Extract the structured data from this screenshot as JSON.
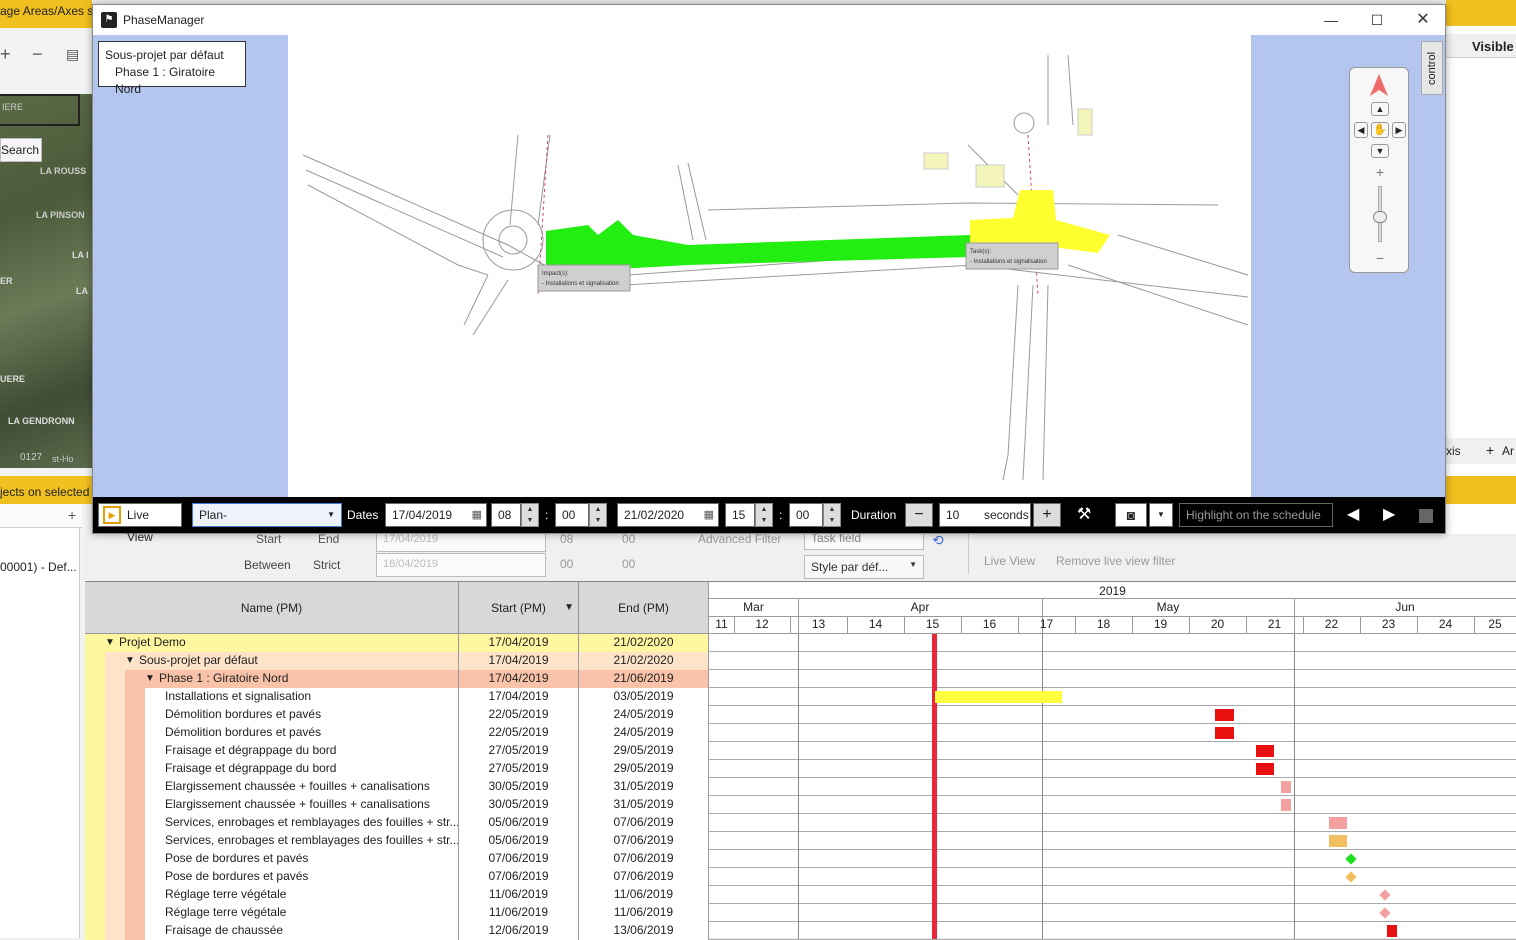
{
  "background": {
    "top_text": "age Areas/Axes s",
    "search_label": "Search",
    "map_labels": [
      "IERE",
      "LA ROUSS",
      "LA PINSON",
      "LA I",
      "ER",
      "LA",
      "UERE",
      "LA GENDRONN",
      "0127",
      "st-Ho"
    ],
    "status_text": "jects on selected",
    "tree_item": "00001) - Def...",
    "right_header": "Visible",
    "right_axis": "xis",
    "right_add": "Ar"
  },
  "window": {
    "title": "PhaseManager",
    "breadcrumb": {
      "line1": "Sous-projet par défaut",
      "line2": "Phase 1 : Giratoire Nord"
    },
    "control_tab": "control",
    "callouts": [
      {
        "title": "Impact(s):",
        "text": "- Installations et signalisation"
      },
      {
        "title": "Task(s):",
        "text": "- Installations et signalisation"
      }
    ]
  },
  "toolbar": {
    "live_view": "Live View",
    "plan_select": "Plan-",
    "dates_label": "Dates",
    "start_date": "17/04/2019",
    "start_hour": "08",
    "start_min": "00",
    "end_date": "21/02/2020",
    "end_hour": "15",
    "end_min": "00",
    "duration_label": "Duration",
    "duration_value": "10",
    "duration_unit": "seconds",
    "highlight_placeholder": "Highlight on the schedule"
  },
  "filters": {
    "start": "Start",
    "end": "End",
    "between": "Between",
    "strict": "Strict",
    "date1": "17/04/2019",
    "date2": "18/04/2019",
    "h1": "08",
    "m1": "00",
    "h2": "00",
    "m2": "00",
    "advanced": "Advanced Filter",
    "task_field": "Task field",
    "style": "Style par déf...",
    "live_view": "Live View",
    "remove_filter": "Remove live view filter"
  },
  "grid": {
    "headers": {
      "name": "Name (PM)",
      "start": "Start (PM)",
      "end": "End (PM)"
    },
    "rows": [
      {
        "name": "Projet Demo",
        "start": "17/04/2019",
        "end": "21/02/2020",
        "level": 0
      },
      {
        "name": "Sous-projet par défaut",
        "start": "17/04/2019",
        "end": "21/02/2020",
        "level": 1
      },
      {
        "name": "Phase 1 : Giratoire Nord",
        "start": "17/04/2019",
        "end": "21/06/2019",
        "level": 2
      },
      {
        "name": "Installations et signalisation",
        "start": "17/04/2019",
        "end": "03/05/2019",
        "level": 3
      },
      {
        "name": "Démolition bordures et pavés",
        "start": "22/05/2019",
        "end": "24/05/2019",
        "level": 3
      },
      {
        "name": "Démolition bordures et pavés",
        "start": "22/05/2019",
        "end": "24/05/2019",
        "level": 3
      },
      {
        "name": "Fraisage et dégrappage du bord",
        "start": "27/05/2019",
        "end": "29/05/2019",
        "level": 3
      },
      {
        "name": "Fraisage et dégrappage du bord",
        "start": "27/05/2019",
        "end": "29/05/2019",
        "level": 3
      },
      {
        "name": "Elargissement chaussée + fouilles + canalisations",
        "start": "30/05/2019",
        "end": "31/05/2019",
        "level": 3
      },
      {
        "name": "Elargissement chaussée + fouilles + canalisations",
        "start": "30/05/2019",
        "end": "31/05/2019",
        "level": 3
      },
      {
        "name": "Services, enrobages et remblayages des fouilles + str...",
        "start": "05/06/2019",
        "end": "07/06/2019",
        "level": 3
      },
      {
        "name": "Services, enrobages et remblayages des fouilles + str...",
        "start": "05/06/2019",
        "end": "07/06/2019",
        "level": 3
      },
      {
        "name": "Pose de bordures et pavés",
        "start": "07/06/2019",
        "end": "07/06/2019",
        "level": 3
      },
      {
        "name": "Pose de bordures et pavés",
        "start": "07/06/2019",
        "end": "07/06/2019",
        "level": 3
      },
      {
        "name": "Réglage terre végétale",
        "start": "11/06/2019",
        "end": "11/06/2019",
        "level": 3
      },
      {
        "name": "Réglage terre végétale",
        "start": "11/06/2019",
        "end": "11/06/2019",
        "level": 3
      },
      {
        "name": "Fraisage de chaussée",
        "start": "12/06/2019",
        "end": "13/06/2019",
        "level": 3
      }
    ]
  },
  "timeline": {
    "year": "2019",
    "months": [
      {
        "label": "Mar"
      },
      {
        "label": "Apr"
      },
      {
        "label": "May"
      },
      {
        "label": "Jun"
      }
    ],
    "weeks": [
      "11",
      "12",
      "13",
      "14",
      "15",
      "16",
      "17",
      "18",
      "19",
      "20",
      "21",
      "22",
      "23",
      "24",
      "25"
    ],
    "bars": [
      {
        "row": 3,
        "shape": "bar",
        "color": "#ffff40"
      },
      {
        "row": 4,
        "shape": "bar",
        "color": "#e81010"
      },
      {
        "row": 5,
        "shape": "bar",
        "color": "#e81010"
      },
      {
        "row": 6,
        "shape": "bar",
        "color": "#e81010"
      },
      {
        "row": 7,
        "shape": "bar",
        "color": "#e81010"
      },
      {
        "row": 8,
        "shape": "bar",
        "color": "#f4a0a0"
      },
      {
        "row": 9,
        "shape": "bar",
        "color": "#f4a0a0"
      },
      {
        "row": 10,
        "shape": "bar",
        "color": "#f4a0a0"
      },
      {
        "row": 11,
        "shape": "bar",
        "color": "#f0c060"
      },
      {
        "row": 12,
        "shape": "diamond",
        "color": "#20e020"
      },
      {
        "row": 13,
        "shape": "diamond",
        "color": "#f0c060"
      },
      {
        "row": 14,
        "shape": "diamond",
        "color": "#f4a0a0"
      },
      {
        "row": 15,
        "shape": "diamond",
        "color": "#f4a0a0"
      },
      {
        "row": 16,
        "shape": "bar",
        "color": "#e81010"
      }
    ],
    "today_color": "#e8283a"
  }
}
